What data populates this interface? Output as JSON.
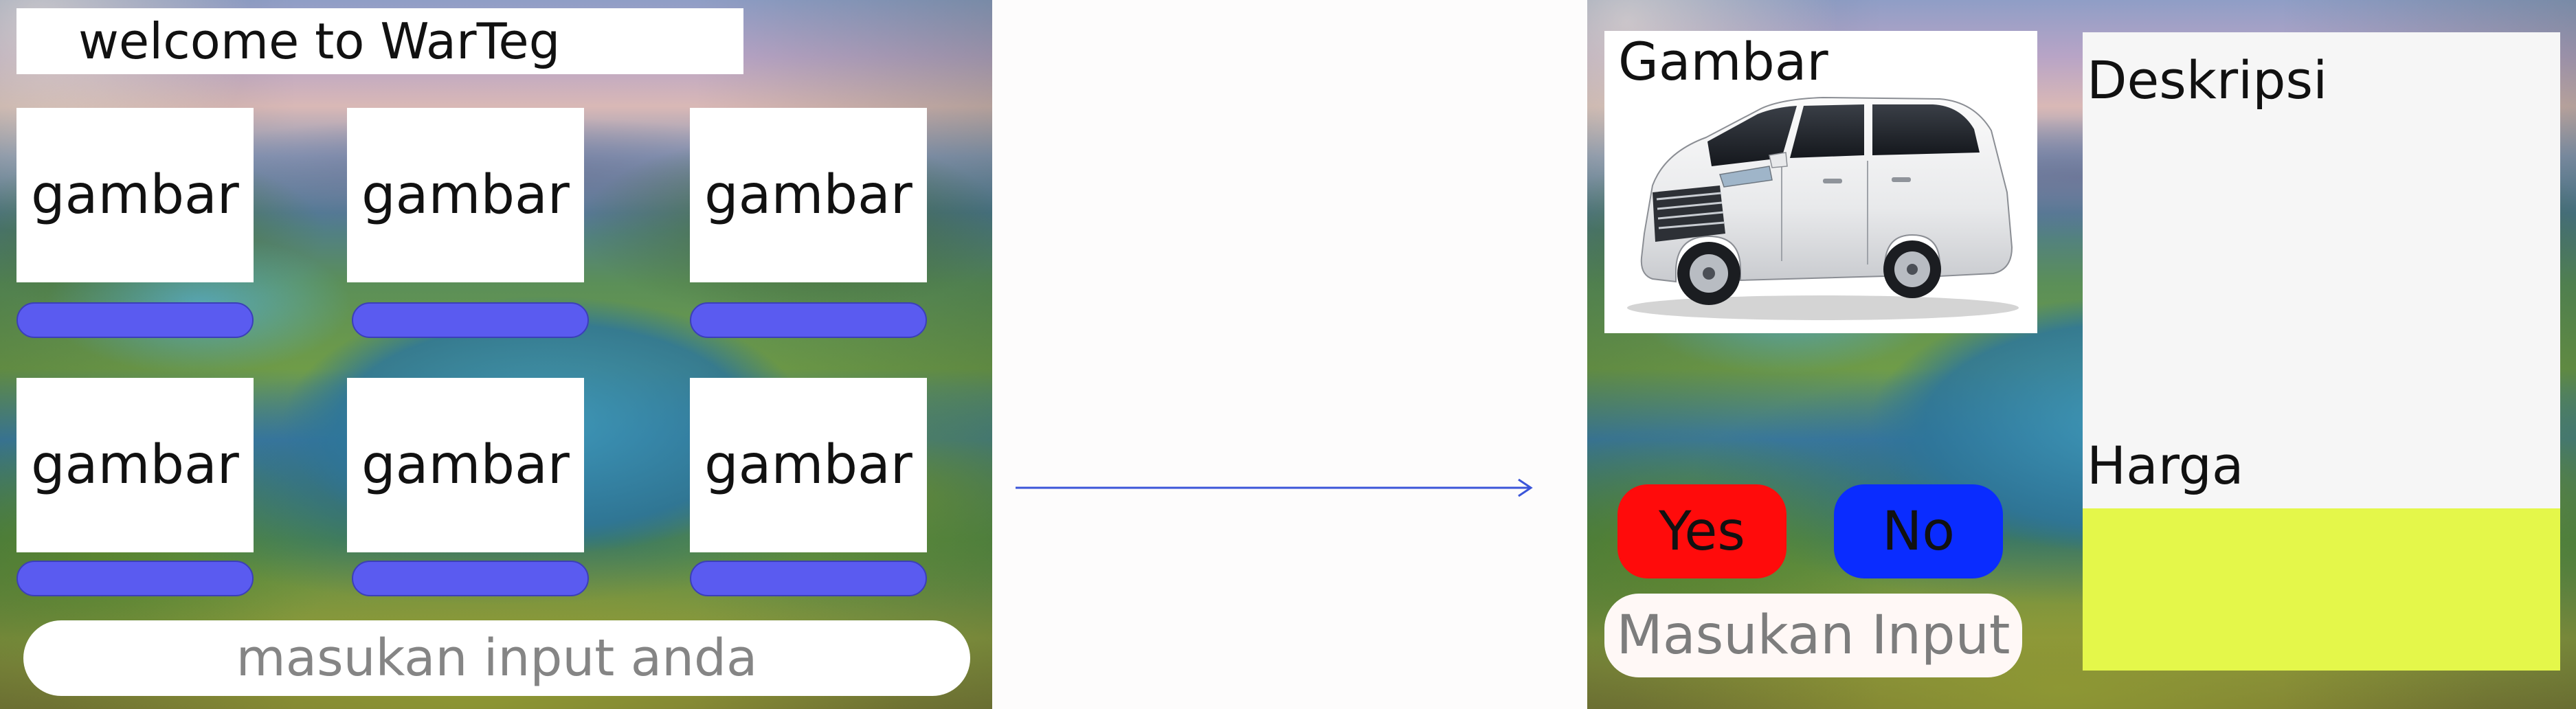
{
  "left_screen": {
    "welcome_text": "welcome to WarTeg",
    "cards": [
      {
        "label": "gambar"
      },
      {
        "label": "gambar"
      },
      {
        "label": "gambar"
      },
      {
        "label": "gambar"
      },
      {
        "label": "gambar"
      },
      {
        "label": "gambar"
      }
    ],
    "search_placeholder": "masukan input anda"
  },
  "right_screen": {
    "image_label": "Gambar",
    "description_label": "Deskripsi",
    "price_label": "Harga",
    "yes_label": "Yes",
    "no_label": "No",
    "input_placeholder": "Masukan Input"
  },
  "colors": {
    "card_bar": "#5a5bf0",
    "yes_button": "#ff0b0b",
    "no_button": "#0a2cff",
    "price_field": "#e4f74a",
    "arrow": "#3b55d9"
  },
  "icons": {
    "flow": "arrow-right-icon",
    "car_image": "minivan-car-image"
  }
}
